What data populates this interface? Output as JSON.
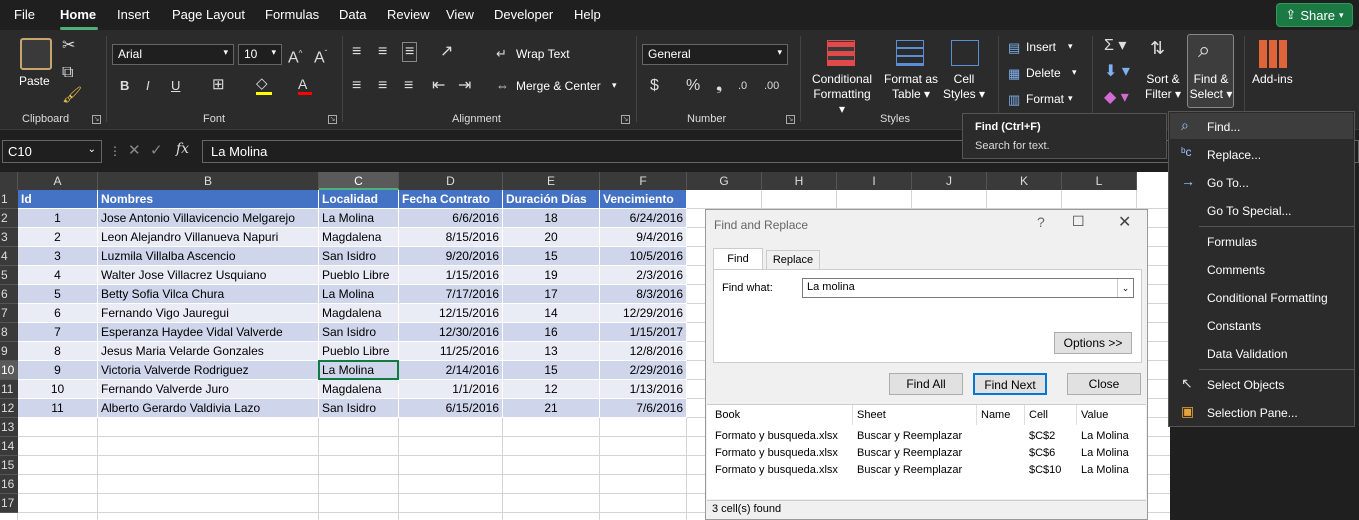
{
  "menubar": {
    "file": "File",
    "home": "Home",
    "insert": "Insert",
    "page_layout": "Page Layout",
    "formulas": "Formulas",
    "data": "Data",
    "review": "Review",
    "view": "View",
    "developer": "Developer",
    "help": "Help",
    "share": "Share"
  },
  "ribbon": {
    "paste": "Paste",
    "clipboard": "Clipboard",
    "font_name": "Arial",
    "font_size": "10",
    "font": "Font",
    "wrap_text": "Wrap Text",
    "merge_center": "Merge & Center",
    "alignment": "Alignment",
    "number_format": "General",
    "number": "Number",
    "conditional_formatting_1": "Conditional",
    "conditional_formatting_2": "Formatting",
    "format_table_1": "Format as",
    "format_table_2": "Table",
    "cell_styles_1": "Cell",
    "cell_styles_2": "Styles",
    "styles": "Styles",
    "insert": "Insert",
    "delete": "Delete",
    "format": "Format",
    "sort_filter_1": "Sort &",
    "sort_filter_2": "Filter",
    "find_select_1": "Find &",
    "find_select_2": "Select",
    "addins": "Add-ins"
  },
  "formula_bar": {
    "name_box": "C10",
    "fx": "fx",
    "value": "La Molina"
  },
  "columns": [
    "A",
    "B",
    "C",
    "D",
    "E",
    "F",
    "G",
    "H",
    "I",
    "J",
    "K",
    "L"
  ],
  "rows": [
    "1",
    "2",
    "3",
    "4",
    "5",
    "6",
    "7",
    "8",
    "9",
    "10",
    "11",
    "12",
    "13",
    "14",
    "15",
    "16",
    "17"
  ],
  "table": {
    "headers": [
      "Id",
      "Nombres",
      "Localidad",
      "Fecha Contrato",
      "Duración Días",
      "Vencimiento"
    ],
    "rows": [
      [
        "1",
        "Jose Antonio Villavicencio Melgarejo",
        "La Molina",
        "6/6/2016",
        "18",
        "6/24/2016"
      ],
      [
        "2",
        "Leon Alejandro  Villanueva  Napuri",
        "Magdalena",
        "8/15/2016",
        "20",
        "9/4/2016"
      ],
      [
        "3",
        "Luzmila  Villalba Ascencio",
        "San Isidro",
        "9/20/2016",
        "15",
        "10/5/2016"
      ],
      [
        "4",
        "Walter Jose Villacrez  Usquiano",
        "Pueblo Libre",
        "1/15/2016",
        "19",
        "2/3/2016"
      ],
      [
        "5",
        "Betty Sofia  Vilca   Chura",
        "La Molina",
        "7/17/2016",
        "17",
        "8/3/2016"
      ],
      [
        "6",
        "Fernando Vigo Jauregui",
        "Magdalena",
        "12/15/2016",
        "14",
        "12/29/2016"
      ],
      [
        "7",
        "Esperanza Haydee Vidal Valverde",
        "San Isidro",
        "12/30/2016",
        "16",
        "1/15/2017"
      ],
      [
        "8",
        "Jesus Maria  Velarde Gonzales",
        "Pueblo Libre",
        "11/25/2016",
        "13",
        "12/8/2016"
      ],
      [
        "9",
        "Victoria Valverde  Rodriguez",
        "La Molina",
        "2/14/2016",
        "15",
        "2/29/2016"
      ],
      [
        "10",
        "Fernando  Valverde  Juro",
        "Magdalena",
        "1/1/2016",
        "12",
        "1/13/2016"
      ],
      [
        "11",
        "Alberto Gerardo  Valdivia  Lazo",
        "San Isidro",
        "6/15/2016",
        "21",
        "7/6/2016"
      ]
    ]
  },
  "dialog": {
    "title": "Find and Replace",
    "tab_find": "Find",
    "tab_replace": "Replace",
    "find_what_label": "Find what:",
    "find_what_value": "La molina",
    "options": "Options >>",
    "find_all": "Find All",
    "find_next": "Find Next",
    "close": "Close",
    "results_headers": [
      "Book",
      "Sheet",
      "Name",
      "Cell",
      "Value"
    ],
    "results": [
      [
        "Formato y busqueda.xlsx",
        "Buscar y Reemplazar",
        "",
        "$C$2",
        "La Molina"
      ],
      [
        "Formato y busqueda.xlsx",
        "Buscar y Reemplazar",
        "",
        "$C$6",
        "La Molina"
      ],
      [
        "Formato y busqueda.xlsx",
        "Buscar y Reemplazar",
        "",
        "$C$10",
        "La Molina"
      ]
    ],
    "status": "3 cell(s) found"
  },
  "tooltip": {
    "title": "Find (Ctrl+F)",
    "text": "Search for text."
  },
  "menu": {
    "find": "Find...",
    "replace": "Replace...",
    "goto": "Go To...",
    "goto_special": "Go To Special...",
    "formulas": "Formulas",
    "comments": "Comments",
    "conditional_formatting": "Conditional Formatting",
    "constants": "Constants",
    "data_validation": "Data Validation",
    "select_objects": "Select Objects",
    "selection_pane": "Selection Pane..."
  },
  "colors": {
    "accent": "#4fb07a",
    "table_header": "#4472c4",
    "band_dark": "#cfd5ea",
    "band_light": "#e9ebf5"
  }
}
